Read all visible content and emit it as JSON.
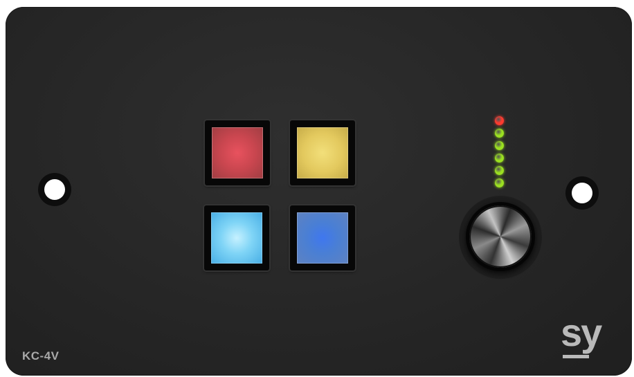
{
  "device": {
    "model": "KC-4V",
    "brand": "sy"
  },
  "keys": [
    {
      "name": "red",
      "color": "#d04a54"
    },
    {
      "name": "yellow",
      "color": "#e8cf66"
    },
    {
      "name": "cyan",
      "color": "#8fdcf8"
    },
    {
      "name": "blue",
      "color": "#4a7fd4"
    }
  ],
  "led_meter": {
    "lit_count": 6,
    "colors": [
      "#ff3b2f",
      "#9be021",
      "#9be021",
      "#9be021",
      "#9be021",
      "#9be021"
    ]
  },
  "colors": {
    "panel": "#282828",
    "label": "#a9a9a9",
    "logo": "#b9b9b9"
  }
}
